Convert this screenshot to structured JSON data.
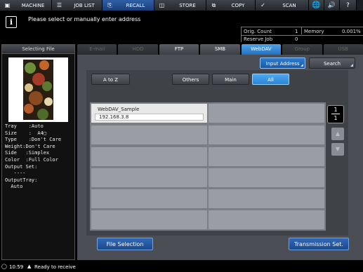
{
  "nav": {
    "machine": "MACHINE",
    "job_list": "JOB LIST",
    "recall": "RECALL",
    "store": "STORE",
    "copy": "COPY",
    "scan": "SCAN"
  },
  "message": "Please select or manually enter address",
  "status": {
    "orig_count_label": "Orig. Count",
    "orig_count_value": "1",
    "memory_label": "Memory",
    "memory_value": "0.001%",
    "reserve_job_label": "Reserve Job",
    "reserve_job_value": "0"
  },
  "left_panel": {
    "title": "Selecting File",
    "props": [
      "Tray    :Auto",
      "Size    :  A4□",
      "Type    :Don't Care",
      "Weight:Don't Care",
      "Side   :Simplex",
      "Color  :Full Color",
      "Output Set:",
      "   ----",
      "OutputTray:",
      "  Auto"
    ]
  },
  "tabs": [
    "E-mail",
    "HDD",
    "FTP",
    "SMB",
    "WebDAV",
    "Group",
    "USB"
  ],
  "buttons": {
    "input_address": "Input Address",
    "search": "Search",
    "a_to_z": "A to Z",
    "others": "Others",
    "main": "Main",
    "all": "All",
    "file_selection": "File Selection",
    "transmission_set": "Transmission Set."
  },
  "address_entries": [
    {
      "name": "WebDAV_Sample",
      "address": "192.168.3.8"
    }
  ],
  "pagination": {
    "current": "1",
    "total": "1"
  },
  "footer": {
    "time": "10:59",
    "status": "Ready to receive"
  }
}
